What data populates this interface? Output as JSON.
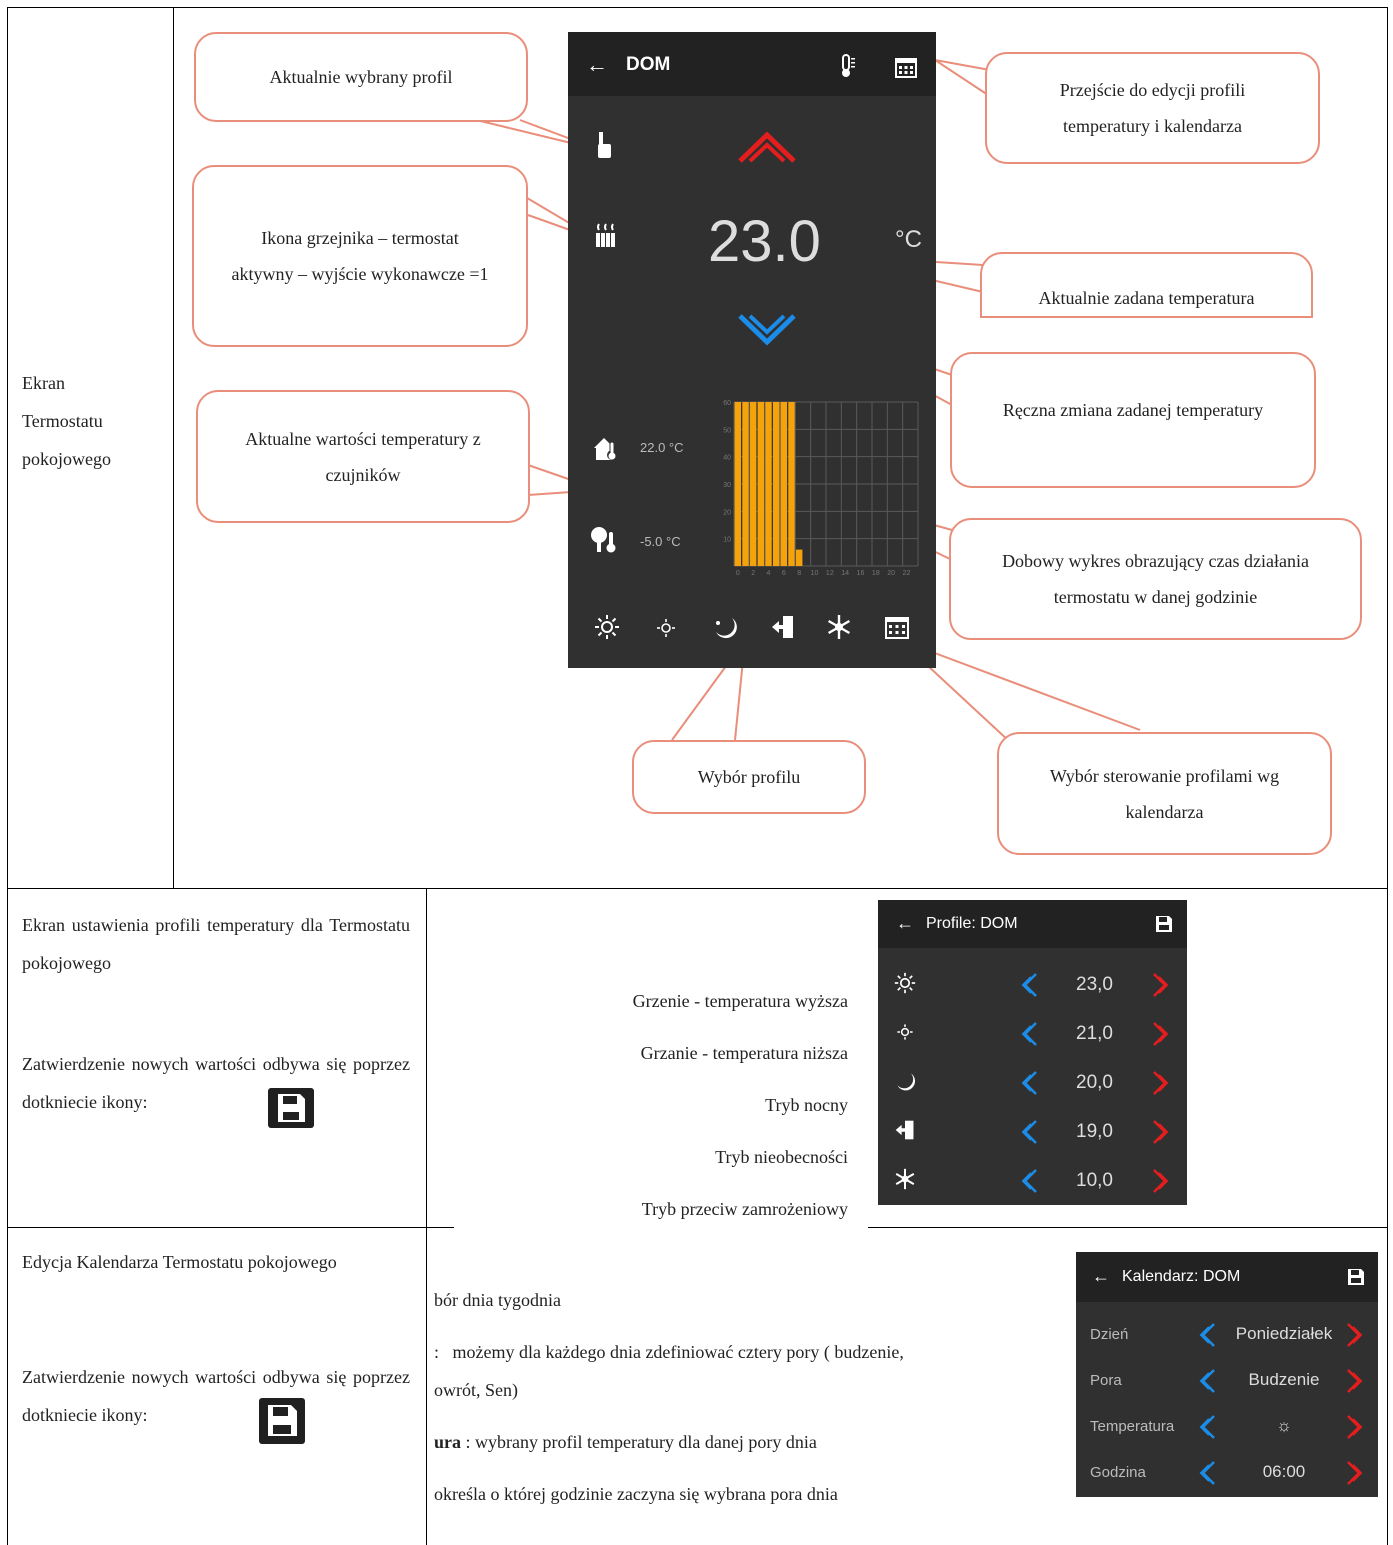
{
  "row1": {
    "label": [
      "Ekran",
      "Termostatu",
      "pokojowego"
    ],
    "phone": {
      "title": "DOM",
      "back_icon": "arrow-left-icon",
      "thermometer_icon": "thermometer-icon",
      "calendar_icon": "calendar-icon",
      "set_temperature": "23.0",
      "unit": "°C",
      "indoor_temp": "22.0 °C",
      "outdoor_temp": "-5.0 °C",
      "profile_icons": [
        "sun-high-icon",
        "sun-low-icon",
        "moon-icon",
        "door-exit-icon",
        "snowflake-icon",
        "calendar-icon"
      ]
    },
    "callouts": {
      "profile": "Aktualnie wybrany profil",
      "heater": "Ikona grzejnika – termostat aktywny – wyjście wykonawcze =1",
      "sensors": "Aktualne wartości temperatury z czujników",
      "edit": "Przejście do edycji profili temperatury i kalendarza",
      "set_temp": "Aktualnie zadana temperatura",
      "manual": "Ręczna zmiana zadanej temperatury",
      "chart": "Dobowy wykres obrazujący czas działania termostatu w danej godzinie",
      "profile_select": "Wybór profilu",
      "calendar_select": "Wybór sterowanie profilami wg kalendarza"
    }
  },
  "chart_data": {
    "type": "bar",
    "categories": [
      "0",
      "1",
      "2",
      "3",
      "4",
      "5",
      "6",
      "7",
      "8",
      "9",
      "10",
      "11",
      "12",
      "13",
      "14",
      "15",
      "16",
      "17",
      "18",
      "19",
      "20",
      "21",
      "22",
      "23"
    ],
    "values": [
      60,
      60,
      60,
      60,
      60,
      60,
      60,
      60,
      6,
      0,
      0,
      0,
      0,
      0,
      0,
      0,
      0,
      0,
      0,
      0,
      0,
      0,
      0,
      0
    ],
    "x_tick_labels": [
      "0",
      "2",
      "4",
      "6",
      "8",
      "10",
      "12",
      "14",
      "16",
      "18",
      "20",
      "22"
    ],
    "y_tick_labels": [
      "10",
      "20",
      "30",
      "40",
      "50",
      "60"
    ],
    "ylim": [
      0,
      60
    ],
    "grid": true,
    "colors": {
      "bar": "#f5a30c",
      "grid": "#5a5a5a"
    }
  },
  "row2": {
    "text1": "Ekran ustawienia profili temperatury dla Termostatu pokojowego",
    "text2": "Zatwierdzenie nowych wartości odbywa się poprzez dotkniecie ikony:",
    "save_icon": "floppy-disk-icon",
    "profile_labels": [
      "Grzenie - temperatura wyższa",
      "Grzanie - temperatura niższa",
      "Tryb nocny",
      "Tryb nieobecności",
      "Tryb przeciw zamrożeniowy"
    ],
    "phone": {
      "title": "Profile: DOM",
      "rows": [
        {
          "icon": "sun-high-icon",
          "value": "23,0"
        },
        {
          "icon": "sun-low-icon",
          "value": "21,0"
        },
        {
          "icon": "moon-icon",
          "value": "20,0"
        },
        {
          "icon": "door-exit-icon",
          "value": "19,0"
        },
        {
          "icon": "snowflake-icon",
          "value": "10,0"
        }
      ]
    }
  },
  "row3": {
    "text1": "Edycja Kalendarza Termostatu pokojowego",
    "text2": "Zatwierdzenie nowych wartości odbywa się poprzez dotkniecie ikony:",
    "desc": {
      "day": "bór dnia tygodnia",
      "pora_prefix": ":",
      "pora": "możemy dla każdego dnia zdefiniować cztery pory ( budzenie,",
      "pora2": "owrót, Sen)",
      "temp_bold": "ura",
      "temp": ": wybrany profil temperatury dla danej pory dnia",
      "hour": "określa o której godzinie zaczyna się wybrana pora dnia"
    },
    "phone": {
      "title": "Kalendarz: DOM",
      "rows": [
        {
          "label": "Dzień",
          "value": "Poniedziałek"
        },
        {
          "label": "Pora",
          "value": "Budzenie"
        },
        {
          "label": "Temperatura",
          "value": "☼"
        },
        {
          "label": "Godzina",
          "value": "06:00"
        }
      ]
    }
  }
}
